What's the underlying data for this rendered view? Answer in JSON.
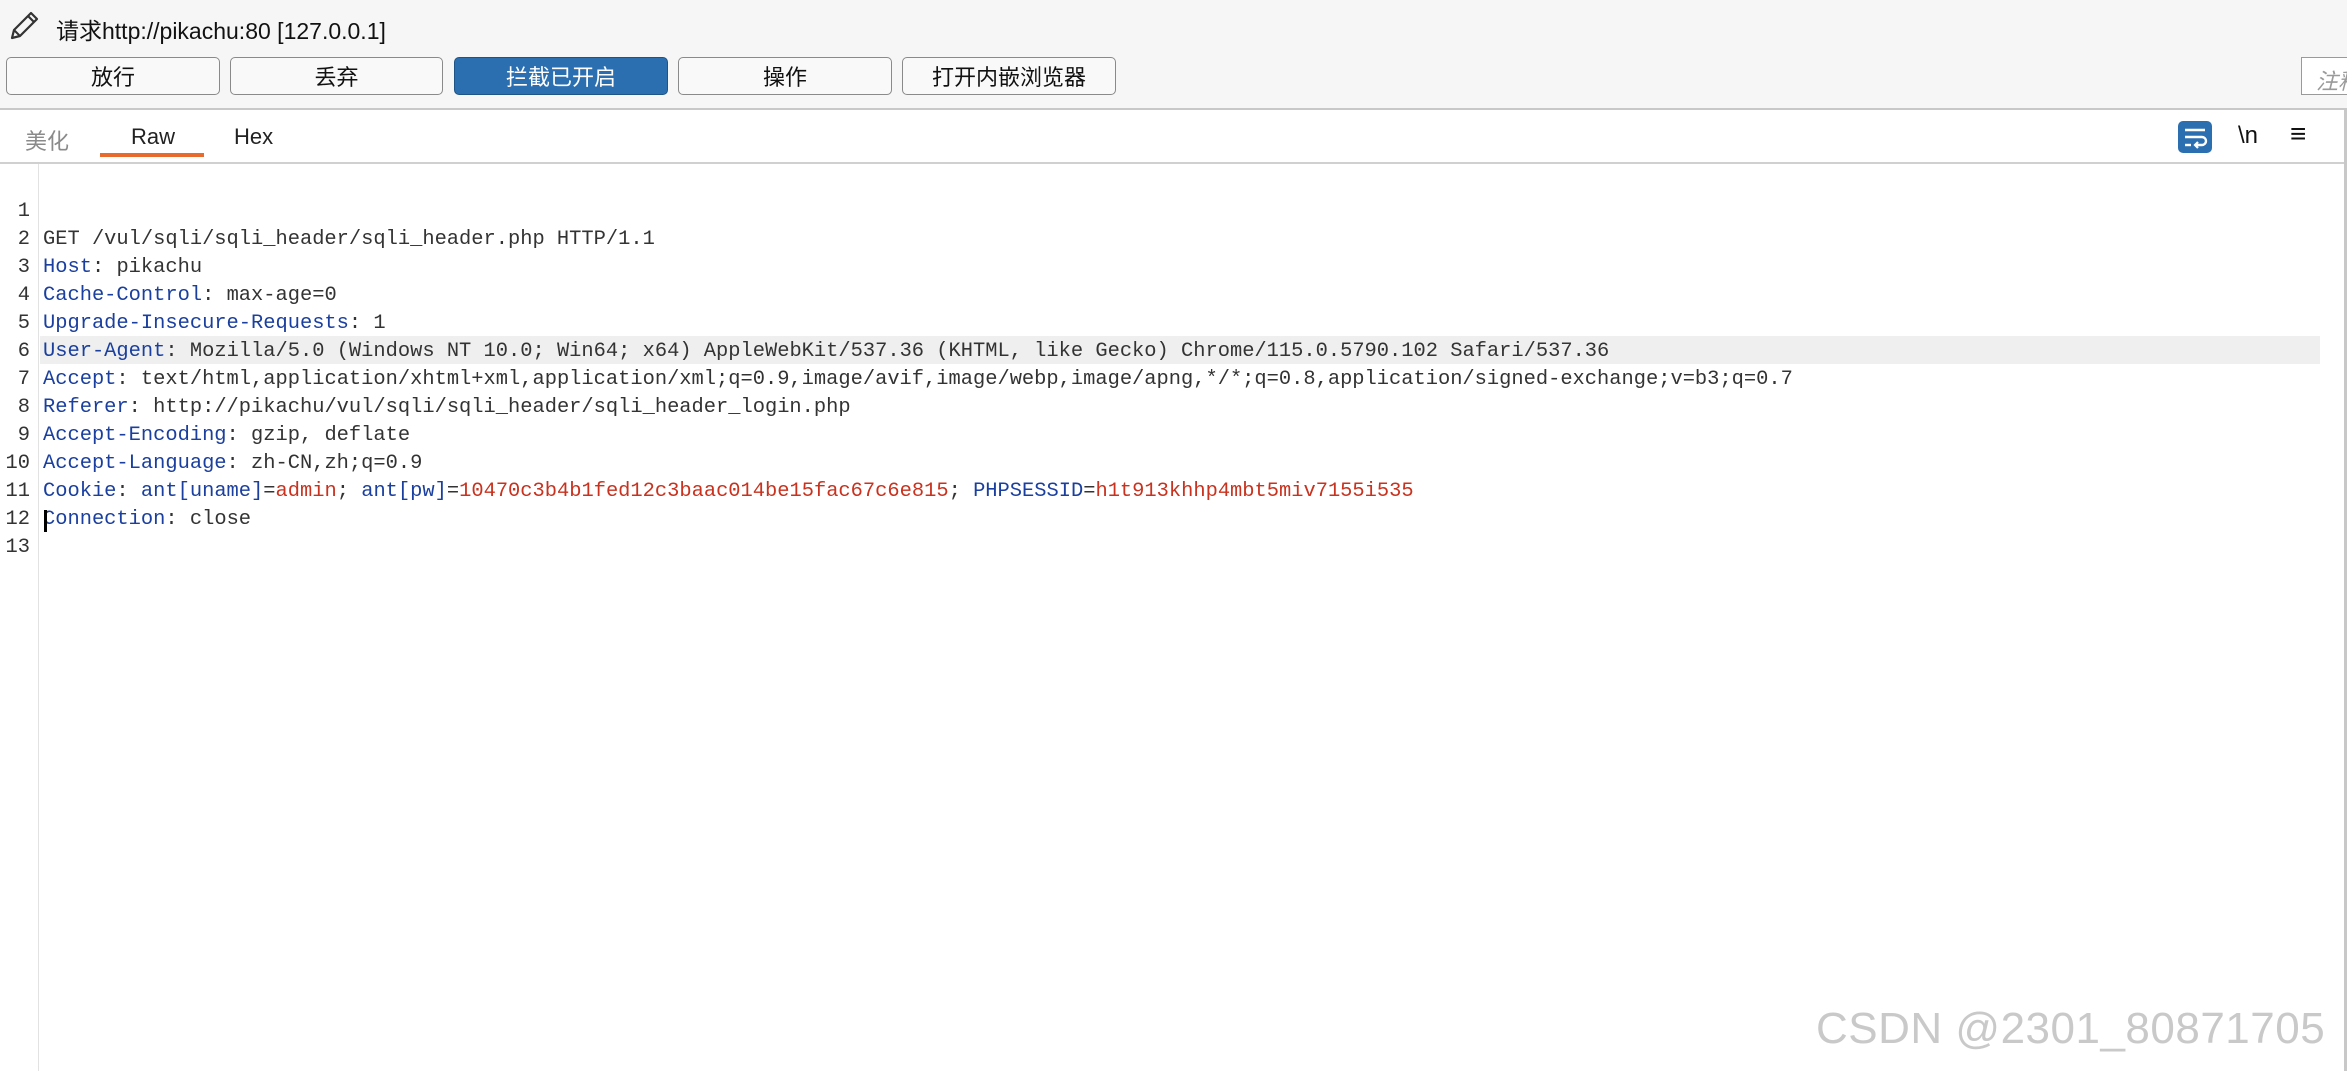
{
  "window": {
    "title": "请求http://pikachu:80  [127.0.0.1]"
  },
  "toolbar": {
    "forward_label": "放行",
    "drop_label": "丢弃",
    "intercept_label": "拦截已开启",
    "action_label": "操作",
    "browser_label": "打开内嵌浏览器",
    "notes_placeholder": "注释"
  },
  "tabs": {
    "pretty": "美化",
    "raw": "Raw",
    "hex": "Hex",
    "active": "Raw"
  },
  "tools": {
    "newline_label": "\\n",
    "menu_label": "≡"
  },
  "editor": {
    "line_numbers": [
      "1",
      "2",
      "3",
      "4",
      "5",
      "6",
      "7",
      "8",
      "9",
      "10",
      "11",
      "12",
      "13"
    ],
    "request_line": "GET /vul/sqli/sqli_header/sqli_header.php HTTP/1.1",
    "headers": [
      {
        "name": "Host",
        "value": "pikachu"
      },
      {
        "name": "Cache-Control",
        "value": "max-age=0"
      },
      {
        "name": "Upgrade-Insecure-Requests",
        "value": "1"
      },
      {
        "name": "User-Agent",
        "value": "Mozilla/5.0 (Windows NT 10.0; Win64; x64) AppleWebKit/537.36 (KHTML, like Gecko) Chrome/115.0.5790.102 Safari/537.36"
      },
      {
        "name": "Accept",
        "value": "text/html,application/xhtml+xml,application/xml;q=0.9,image/avif,image/webp,image/apng,*/*;q=0.8,application/signed-exchange;v=b3;q=0.7"
      },
      {
        "name": "Referer",
        "value": "http://pikachu/vul/sqli/sqli_header/sqli_header_login.php"
      },
      {
        "name": "Accept-Encoding",
        "value": "gzip, deflate"
      },
      {
        "name": "Accept-Language",
        "value": "zh-CN,zh;q=0.9"
      }
    ],
    "cookie": {
      "name": "Cookie",
      "pairs": [
        {
          "name": "ant[uname]",
          "value": "admin"
        },
        {
          "name": "ant[pw]",
          "value": "10470c3b4b1fed12c3baac014be15fac67c6e815"
        },
        {
          "name": "PHPSESSID",
          "value": "h1t913khhp4mbt5miv7155i535"
        }
      ]
    },
    "connection": {
      "name": "Connection",
      "value": "close"
    }
  },
  "watermark": "CSDN @2301_80871705",
  "colors": {
    "accent": "#2c6fb0",
    "tab_underline": "#e86a2d",
    "header_name": "#1a3f9e",
    "cookie_value": "#c8321e"
  }
}
